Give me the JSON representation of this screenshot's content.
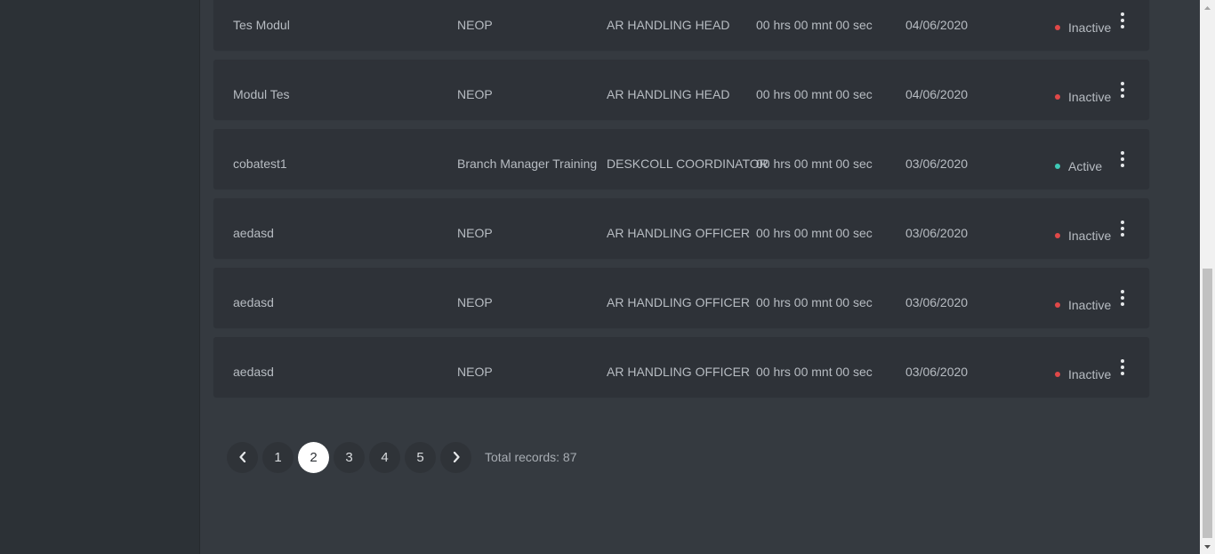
{
  "rows": [
    {
      "name": "Tes Modul",
      "category": "NEOP",
      "role": "AR HANDLING HEAD",
      "duration": "00 hrs 00 mnt 00 sec",
      "date": "04/06/2020",
      "status": "Inactive",
      "status_color": "#e04848"
    },
    {
      "name": "Modul Tes",
      "category": "NEOP",
      "role": "AR HANDLING HEAD",
      "duration": "00 hrs 00 mnt 00 sec",
      "date": "04/06/2020",
      "status": "Inactive",
      "status_color": "#e04848"
    },
    {
      "name": "cobatest1",
      "category": "Branch Manager Training",
      "role": "DESKCOLL COORDINATOR",
      "duration": "00 hrs 00 mnt 00 sec",
      "date": "03/06/2020",
      "status": "Active",
      "status_color": "#3ec9b6"
    },
    {
      "name": "aedasd",
      "category": "NEOP",
      "role": "AR HANDLING OFFICER",
      "duration": "00 hrs 00 mnt 00 sec",
      "date": "03/06/2020",
      "status": "Inactive",
      "status_color": "#e04848"
    },
    {
      "name": "aedasd",
      "category": "NEOP",
      "role": "AR HANDLING OFFICER",
      "duration": "00 hrs 00 mnt 00 sec",
      "date": "03/06/2020",
      "status": "Inactive",
      "status_color": "#e04848"
    },
    {
      "name": "aedasd",
      "category": "NEOP",
      "role": "AR HANDLING OFFICER",
      "duration": "00 hrs 00 mnt 00 sec",
      "date": "03/06/2020",
      "status": "Inactive",
      "status_color": "#e04848"
    }
  ],
  "pagination": {
    "prev_icon": "chevron-left-icon",
    "next_icon": "chevron-right-icon",
    "pages": [
      "1",
      "2",
      "3",
      "4",
      "5"
    ],
    "current_page": "2",
    "total_label": "Total records: 87"
  },
  "colors": {
    "sidebar_bg": "#2c3136",
    "content_bg": "#353a40",
    "row_bg": "#2e3238",
    "inactive": "#e04848",
    "active": "#3ec9b6"
  },
  "icons": {
    "row_menu": "kebab-menu-icon"
  }
}
